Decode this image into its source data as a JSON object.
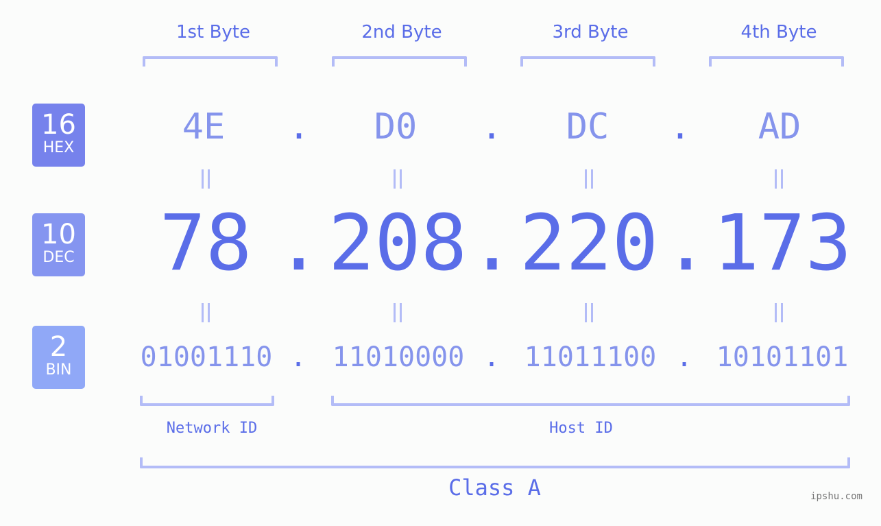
{
  "ip_address": "78.208.220.173",
  "byte_headers": [
    "1st Byte",
    "2nd Byte",
    "3rd Byte",
    "4th Byte"
  ],
  "badges": {
    "hex": {
      "base": "16",
      "label": "HEX",
      "color": "#7682ec"
    },
    "dec": {
      "base": "10",
      "label": "DEC",
      "color": "#8595f0"
    },
    "bin": {
      "base": "2",
      "label": "BIN",
      "color": "#90a8f7"
    }
  },
  "hex_values": [
    "4E",
    "D0",
    "DC",
    "AD"
  ],
  "dec_values": [
    "78",
    "208",
    "220",
    "173"
  ],
  "bin_values": [
    "01001110",
    "11010000",
    "11011100",
    "10101101"
  ],
  "separator": ".",
  "network_id_label": "Network ID",
  "host_id_label": "Host ID",
  "class_label": "Class A",
  "watermark": "ipshu.com",
  "colors": {
    "primary": "#5a6de8",
    "secondary": "#8594ec",
    "bracket": "#b3bcf7",
    "background": "#fbfcfb"
  }
}
